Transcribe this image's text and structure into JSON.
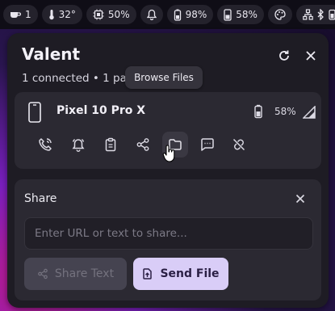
{
  "topbar": {
    "workspace_count": "1",
    "temperature": "32°",
    "cpu": "50%",
    "phone_battery": "98%",
    "battery": "58%"
  },
  "panel": {
    "title": "Valent",
    "subtitle": "1 connected • 1 paired"
  },
  "device": {
    "name": "Pixel 10 Pro X",
    "battery": "58%",
    "tooltip": "Browse Files"
  },
  "share": {
    "title": "Share",
    "placeholder": "Enter URL or text to share...",
    "share_text_label": "Share Text",
    "send_file_label": "Send File"
  },
  "colors": {
    "panel_bg": "#1e1c24",
    "card_bg": "#2b2932",
    "accent": "#d9cdf7"
  }
}
